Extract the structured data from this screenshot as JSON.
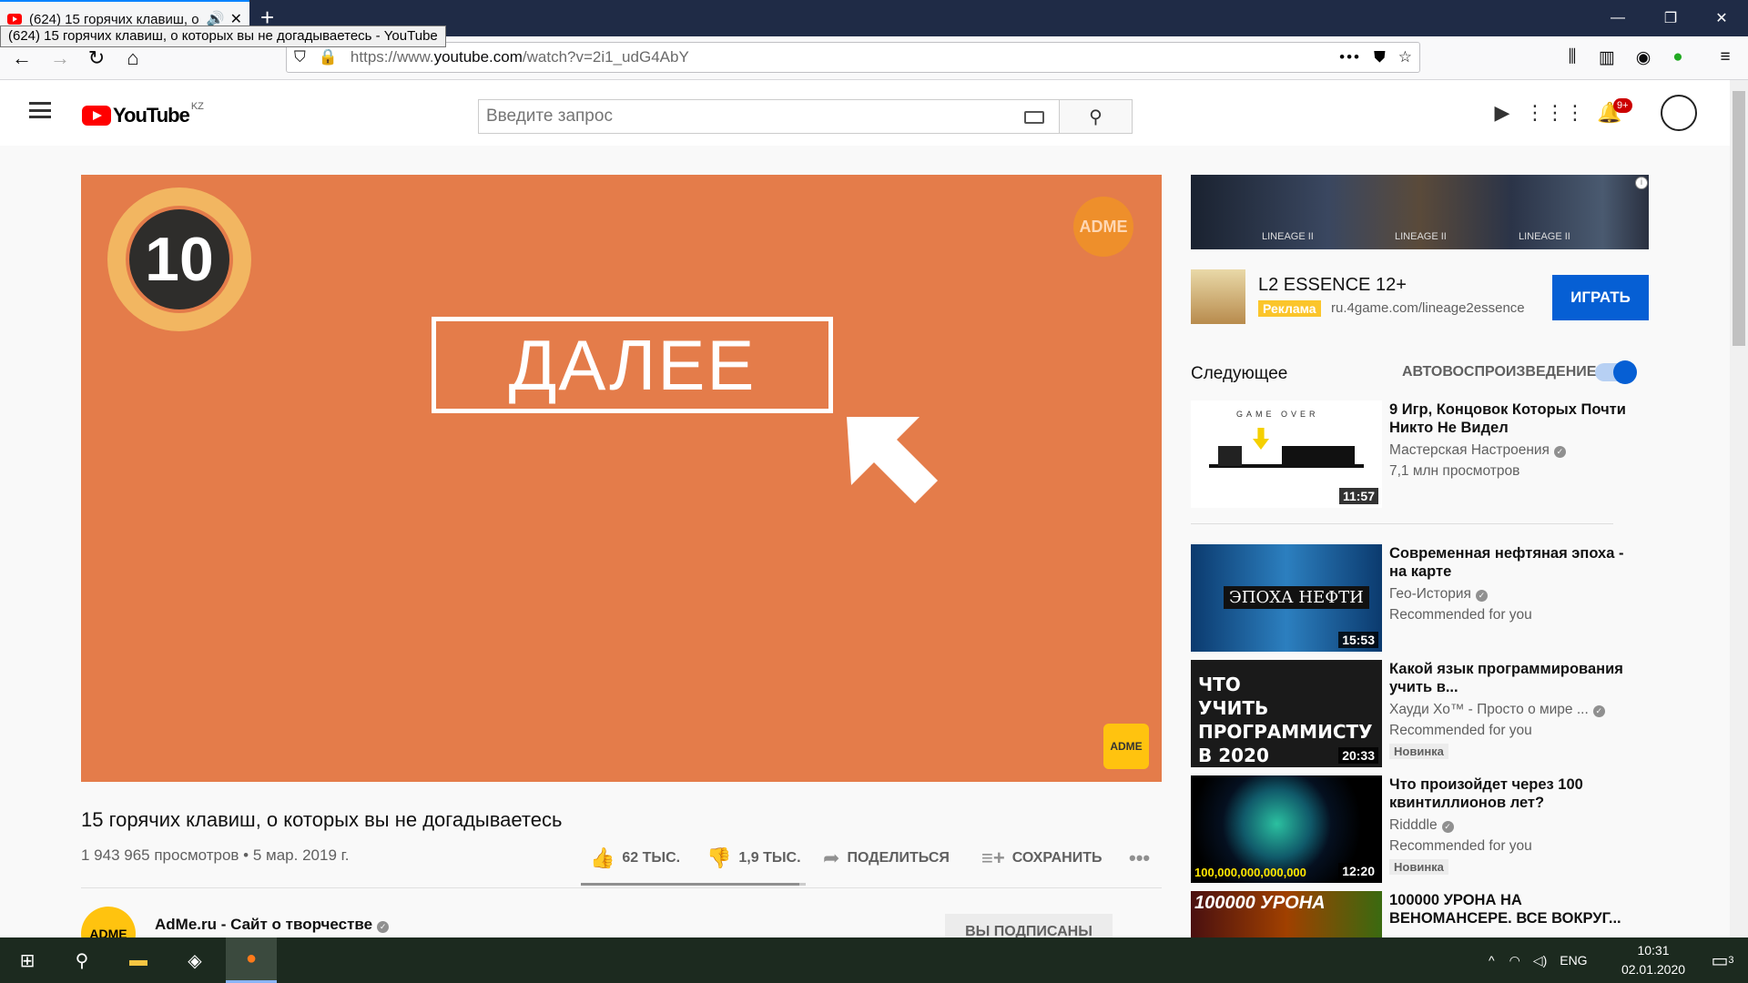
{
  "browser": {
    "tab_title": "(624) 15 горячих клавиш, о",
    "tooltip": "(624) 15 горячих клавиш, о которых вы не догадываетесь - YouTube",
    "url_prefix": "https://www.",
    "url_domain": "youtube.com",
    "url_path": "/watch?v=2i1_udG4AbY"
  },
  "youtube": {
    "logo_text": "YouTube",
    "region": "KZ",
    "search_placeholder": "Введите запрос",
    "notif_count": "9+"
  },
  "video": {
    "number": "10",
    "watermark": "ADME",
    "button_text": "ДАЛЕЕ",
    "title": "15 горячих клавиш, о которых вы не догадываетесь",
    "meta": "1 943 965 просмотров • 5 мар. 2019 г.",
    "likes": "62 ТЫС.",
    "dislikes": "1,9 ТЫС.",
    "like_ratio": 0.97,
    "share": "ПОДЕЛИТЬСЯ",
    "save": "СОХРАНИТЬ",
    "channel": "AdMe.ru - Сайт о творчестве",
    "subscribe": "ВЫ ПОДПИСАНЫ"
  },
  "ad": {
    "banner_labels": [
      "LINEAGE II",
      "LINEAGE II",
      "LINEAGE II"
    ],
    "title": "L2 ESSENCE 12+",
    "tag": "Реклама",
    "url": "ru.4game.com/lineage2essence",
    "button": "ИГРАТЬ"
  },
  "sidebar": {
    "next_label": "Следующее",
    "autoplay_label": "АВТОВОСПРОИЗВЕДЕНИЕ",
    "autoplay_on": true,
    "items": [
      {
        "title": "9 Игр, Концовок Которых Почти Никто Не Видел",
        "channel": "Мастерская Настроения",
        "views": "7,1 млн просмотров",
        "duration": "11:57",
        "thumb_text": "GAME OVER",
        "new": ""
      },
      {
        "title": "Современная нефтяная эпоха - на карте",
        "channel": "Гео-История",
        "views": "Recommended for you",
        "duration": "15:53",
        "thumb_text": "ЭПОХА НЕФТИ",
        "new": ""
      },
      {
        "title": "Какой язык программирования учить в...",
        "channel": "Хауди Хо™ - Просто о мире ...",
        "views": "Recommended for you",
        "duration": "20:33",
        "thumb_text": "ЧТО УЧИТЬ ПРОГРАММИСТУ В 2020",
        "new": "Новинка"
      },
      {
        "title": "Что произойдет через 100 квинтиллионов лет?",
        "channel": "Ridddle",
        "views": "Recommended for you",
        "duration": "12:20",
        "thumb_text": "100,000,000,000,000",
        "new": "Новинка"
      },
      {
        "title": "100000 УРОНА НА ВЕНОМАНСЕРЕ. ВСЕ ВОКРУГ...",
        "channel": "",
        "views": "",
        "duration": "",
        "thumb_text": "100000 УРОНА",
        "new": ""
      }
    ]
  },
  "taskbar": {
    "lang": "ENG",
    "time": "10:31",
    "date": "02.01.2020",
    "notifications": "3"
  }
}
